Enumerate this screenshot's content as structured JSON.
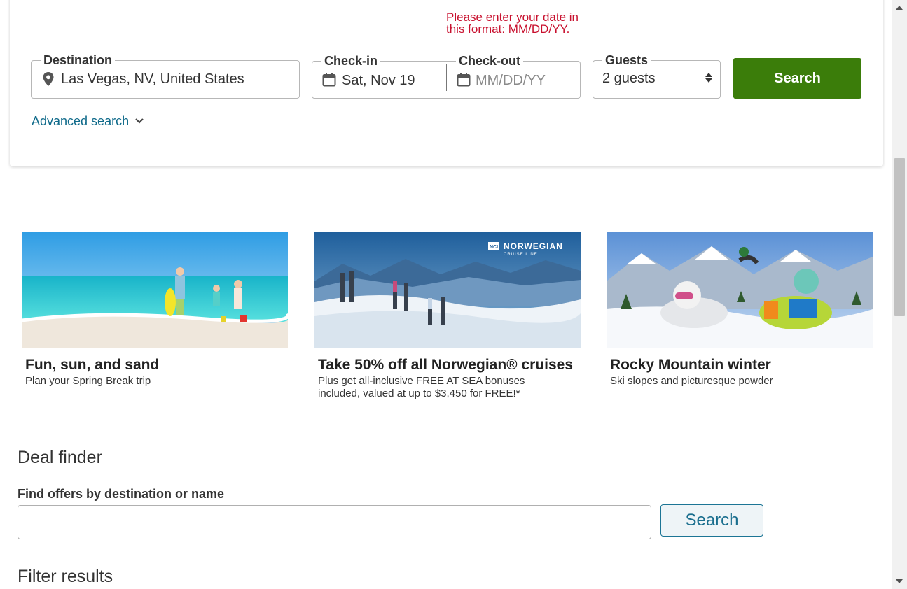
{
  "search": {
    "error_message": "Please enter your date in this format: MM/DD/YY.",
    "destination_label": "Destination",
    "destination_value": "Las Vegas, NV, United States",
    "checkin_label": "Check-in",
    "checkin_value": "Sat, Nov 19",
    "checkout_label": "Check-out",
    "checkout_placeholder": "MM/DD/YY",
    "guests_label": "Guests",
    "guests_value": "2 guests",
    "search_button": "Search",
    "advanced_search": "Advanced search"
  },
  "promos": [
    {
      "title": "Fun, sun, and sand",
      "subtitle": "Plan your Spring Break trip"
    },
    {
      "title": "Take 50% off all Norwegian® cruises",
      "subtitle": "Plus get all-inclusive FREE AT SEA bonuses included, valued at up to $3,450 for FREE!*",
      "brand": "NORWEGIAN",
      "brand_sub": "CRUISE LINE",
      "brand_badge": "NCL"
    },
    {
      "title": "Rocky Mountain winter",
      "subtitle": "Ski slopes and picturesque powder"
    }
  ],
  "deal_finder": {
    "title": "Deal finder",
    "label": "Find offers by destination or name",
    "input_value": "",
    "button": "Search"
  },
  "filter_results": {
    "title": "Filter results"
  },
  "colors": {
    "primary_green": "#3b7d0a",
    "link_teal": "#0f6a8a",
    "error_red": "#c8102e"
  },
  "icons": [
    "location-pin-icon",
    "calendar-icon",
    "chevron-down-icon",
    "select-arrows-icon"
  ]
}
